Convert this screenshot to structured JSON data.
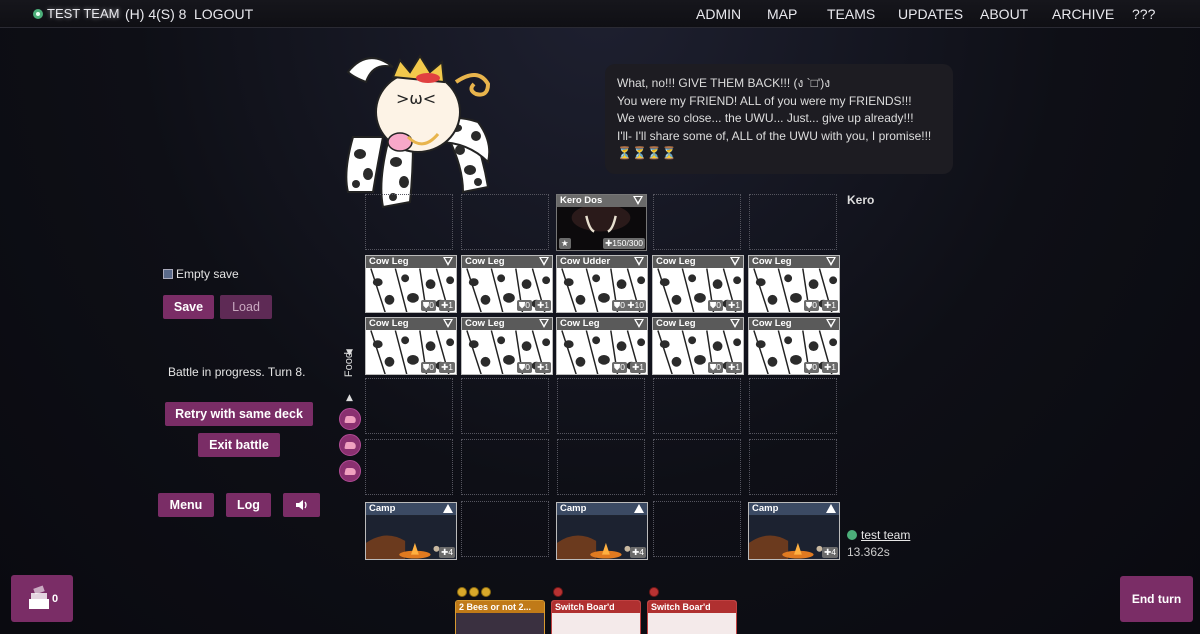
{
  "nav": {
    "team_name": "TEST TEAM",
    "score": "(H) 4(S) 8",
    "logout": "LOGOUT",
    "links": [
      "ADMIN",
      "MAP",
      "TEAMS",
      "UPDATES",
      "ABOUT",
      "ARCHIVE",
      "???"
    ]
  },
  "dialogue": {
    "lines": [
      "What, no!!! GIVE THEM BACK!!! (ง `□')ง",
      "You were my FRIEND! ALL of you were my FRIENDS!!!",
      "We were so close... the UWU... Just... give up already!!!",
      "I'll- I'll share some of, ALL of the UWU with you, I promise!!!",
      "⏳⏳⏳⏳"
    ]
  },
  "opponent": {
    "name": "Kero"
  },
  "board": {
    "kero_card": {
      "name": "Kero Dos",
      "hp": "150/300"
    },
    "row1": [
      {
        "name": "Cow Leg",
        "def": "0",
        "hp": "1"
      },
      {
        "name": "Cow Leg",
        "def": "0",
        "hp": "1"
      },
      {
        "name": "Cow Udder",
        "def": "0",
        "hp": "10"
      },
      {
        "name": "Cow Leg",
        "def": "0",
        "hp": "1"
      },
      {
        "name": "Cow Leg",
        "def": "0",
        "hp": "1"
      }
    ],
    "row2": [
      {
        "name": "Cow Leg",
        "def": "0",
        "hp": "1"
      },
      {
        "name": "Cow Leg",
        "def": "0",
        "hp": "1"
      },
      {
        "name": "Cow Leg",
        "def": "0",
        "hp": "1"
      },
      {
        "name": "Cow Leg",
        "def": "0",
        "hp": "1"
      },
      {
        "name": "Cow Leg",
        "def": "0",
        "hp": "1"
      }
    ],
    "camps": [
      {
        "name": "Camp",
        "hp": "4"
      },
      {
        "name": "Camp",
        "hp": "4"
      },
      {
        "name": "Camp",
        "hp": "4"
      }
    ]
  },
  "panel": {
    "save_status": "Empty save",
    "save": "Save",
    "load": "Load",
    "battle_status": "Battle in progress. Turn 8.",
    "retry": "Retry with same deck",
    "exit": "Exit battle",
    "menu": "Menu",
    "log": "Log"
  },
  "food": {
    "label": "Food",
    "up": "▲",
    "down": "▼"
  },
  "player": {
    "name": "test team",
    "timer": "13.362s"
  },
  "deck": {
    "count": "0"
  },
  "end_turn": "End turn",
  "hand": [
    {
      "name": "2 Bees or not 2...",
      "cost_type": "coin",
      "cost": 3
    },
    {
      "name": "Switch Boar'd",
      "cost_type": "blood",
      "cost": 1
    },
    {
      "name": "Switch Boar'd",
      "cost_type": "blood",
      "cost": 1
    }
  ],
  "colors": {
    "accent": "#7a2d66",
    "team": "#4caf7a"
  }
}
